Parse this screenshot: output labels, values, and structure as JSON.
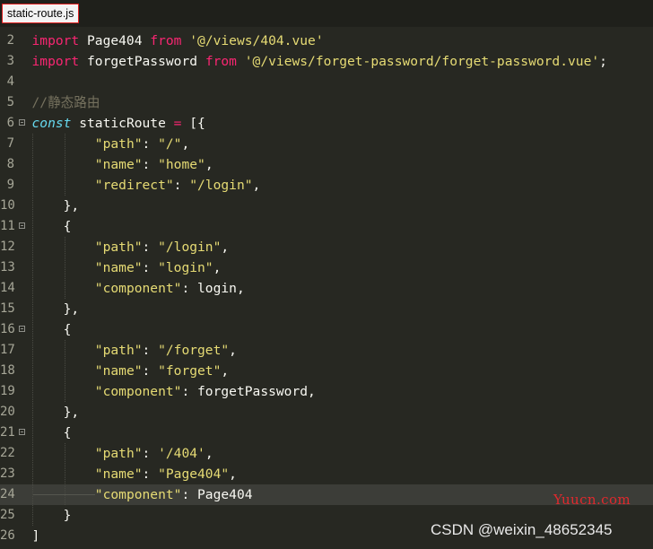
{
  "tab": {
    "filename": "static-route.js"
  },
  "editor": {
    "current_line": 24,
    "lines": [
      {
        "num": 2,
        "fold": false,
        "tokens": [
          {
            "t": "import",
            "c": "kw"
          },
          {
            "t": " Page404 ",
            "c": "plain"
          },
          {
            "t": "from",
            "c": "kw"
          },
          {
            "t": " ",
            "c": "plain"
          },
          {
            "t": "'@/views/404.vue'",
            "c": "str"
          }
        ]
      },
      {
        "num": 3,
        "fold": false,
        "tokens": [
          {
            "t": "import",
            "c": "kw"
          },
          {
            "t": " forgetPassword ",
            "c": "plain"
          },
          {
            "t": "from",
            "c": "kw"
          },
          {
            "t": " ",
            "c": "plain"
          },
          {
            "t": "'@/views/forget-password/forget-password.vue'",
            "c": "str"
          },
          {
            "t": ";",
            "c": "plain"
          }
        ]
      },
      {
        "num": 4,
        "fold": false,
        "tokens": []
      },
      {
        "num": 5,
        "fold": false,
        "tokens": [
          {
            "t": "//静态路由",
            "c": "cm"
          }
        ]
      },
      {
        "num": 6,
        "fold": true,
        "tokens": [
          {
            "t": "const",
            "c": "decl"
          },
          {
            "t": " staticRoute ",
            "c": "plain"
          },
          {
            "t": "=",
            "c": "kw"
          },
          {
            "t": " [{",
            "c": "plain"
          }
        ]
      },
      {
        "num": 7,
        "fold": false,
        "tokens": [
          {
            "t": "        ",
            "c": "plain"
          },
          {
            "t": "\"path\"",
            "c": "str"
          },
          {
            "t": ": ",
            "c": "plain"
          },
          {
            "t": "\"/\"",
            "c": "str"
          },
          {
            "t": ",",
            "c": "plain"
          }
        ]
      },
      {
        "num": 8,
        "fold": false,
        "tokens": [
          {
            "t": "        ",
            "c": "plain"
          },
          {
            "t": "\"name\"",
            "c": "str"
          },
          {
            "t": ": ",
            "c": "plain"
          },
          {
            "t": "\"home\"",
            "c": "str"
          },
          {
            "t": ",",
            "c": "plain"
          }
        ]
      },
      {
        "num": 9,
        "fold": false,
        "tokens": [
          {
            "t": "        ",
            "c": "plain"
          },
          {
            "t": "\"redirect\"",
            "c": "str"
          },
          {
            "t": ": ",
            "c": "plain"
          },
          {
            "t": "\"/login\"",
            "c": "str"
          },
          {
            "t": ",",
            "c": "plain"
          }
        ]
      },
      {
        "num": 10,
        "fold": false,
        "tokens": [
          {
            "t": "    },",
            "c": "plain"
          }
        ]
      },
      {
        "num": 11,
        "fold": true,
        "tokens": [
          {
            "t": "    {",
            "c": "plain"
          }
        ]
      },
      {
        "num": 12,
        "fold": false,
        "tokens": [
          {
            "t": "        ",
            "c": "plain"
          },
          {
            "t": "\"path\"",
            "c": "str"
          },
          {
            "t": ": ",
            "c": "plain"
          },
          {
            "t": "\"/login\"",
            "c": "str"
          },
          {
            "t": ",",
            "c": "plain"
          }
        ]
      },
      {
        "num": 13,
        "fold": false,
        "tokens": [
          {
            "t": "        ",
            "c": "plain"
          },
          {
            "t": "\"name\"",
            "c": "str"
          },
          {
            "t": ": ",
            "c": "plain"
          },
          {
            "t": "\"login\"",
            "c": "str"
          },
          {
            "t": ",",
            "c": "plain"
          }
        ]
      },
      {
        "num": 14,
        "fold": false,
        "tokens": [
          {
            "t": "        ",
            "c": "plain"
          },
          {
            "t": "\"component\"",
            "c": "str"
          },
          {
            "t": ": login,",
            "c": "plain"
          }
        ]
      },
      {
        "num": 15,
        "fold": false,
        "tokens": [
          {
            "t": "    },",
            "c": "plain"
          }
        ]
      },
      {
        "num": 16,
        "fold": true,
        "tokens": [
          {
            "t": "    {",
            "c": "plain"
          }
        ]
      },
      {
        "num": 17,
        "fold": false,
        "tokens": [
          {
            "t": "        ",
            "c": "plain"
          },
          {
            "t": "\"path\"",
            "c": "str"
          },
          {
            "t": ": ",
            "c": "plain"
          },
          {
            "t": "\"/forget\"",
            "c": "str"
          },
          {
            "t": ",",
            "c": "plain"
          }
        ]
      },
      {
        "num": 18,
        "fold": false,
        "tokens": [
          {
            "t": "        ",
            "c": "plain"
          },
          {
            "t": "\"name\"",
            "c": "str"
          },
          {
            "t": ": ",
            "c": "plain"
          },
          {
            "t": "\"forget\"",
            "c": "str"
          },
          {
            "t": ",",
            "c": "plain"
          }
        ]
      },
      {
        "num": 19,
        "fold": false,
        "tokens": [
          {
            "t": "        ",
            "c": "plain"
          },
          {
            "t": "\"component\"",
            "c": "str"
          },
          {
            "t": ": forgetPassword,",
            "c": "plain"
          }
        ]
      },
      {
        "num": 20,
        "fold": false,
        "tokens": [
          {
            "t": "    },",
            "c": "plain"
          }
        ]
      },
      {
        "num": 21,
        "fold": true,
        "tokens": [
          {
            "t": "    {",
            "c": "plain"
          }
        ]
      },
      {
        "num": 22,
        "fold": false,
        "tokens": [
          {
            "t": "        ",
            "c": "plain"
          },
          {
            "t": "\"path\"",
            "c": "str"
          },
          {
            "t": ": ",
            "c": "plain"
          },
          {
            "t": "'/404'",
            "c": "str"
          },
          {
            "t": ",",
            "c": "plain"
          }
        ]
      },
      {
        "num": 23,
        "fold": false,
        "tokens": [
          {
            "t": "        ",
            "c": "plain"
          },
          {
            "t": "\"name\"",
            "c": "str"
          },
          {
            "t": ": ",
            "c": "plain"
          },
          {
            "t": "\"Page404\"",
            "c": "str"
          },
          {
            "t": ",",
            "c": "plain"
          }
        ]
      },
      {
        "num": 24,
        "fold": false,
        "tokens": [
          {
            "t": "        ",
            "c": "plain"
          },
          {
            "t": "\"component\"",
            "c": "str"
          },
          {
            "t": ": Page404",
            "c": "plain"
          }
        ]
      },
      {
        "num": 25,
        "fold": false,
        "tokens": [
          {
            "t": "    }",
            "c": "plain"
          }
        ]
      },
      {
        "num": 26,
        "fold": false,
        "tokens": [
          {
            "t": "]",
            "c": "plain"
          }
        ]
      }
    ]
  },
  "watermarks": {
    "site": "Yuucn.com",
    "author": "CSDN @weixin_48652345"
  },
  "colors": {
    "background": "#272822",
    "keyword": "#f92672",
    "string": "#e6db74",
    "comment": "#75715e",
    "declaration": "#66d9ef",
    "plain": "#f8f8f2",
    "gutter": "#a6a697",
    "current_line": "#3c3d38",
    "tab_border": "#e02020",
    "site_watermark": "#e0292d"
  }
}
